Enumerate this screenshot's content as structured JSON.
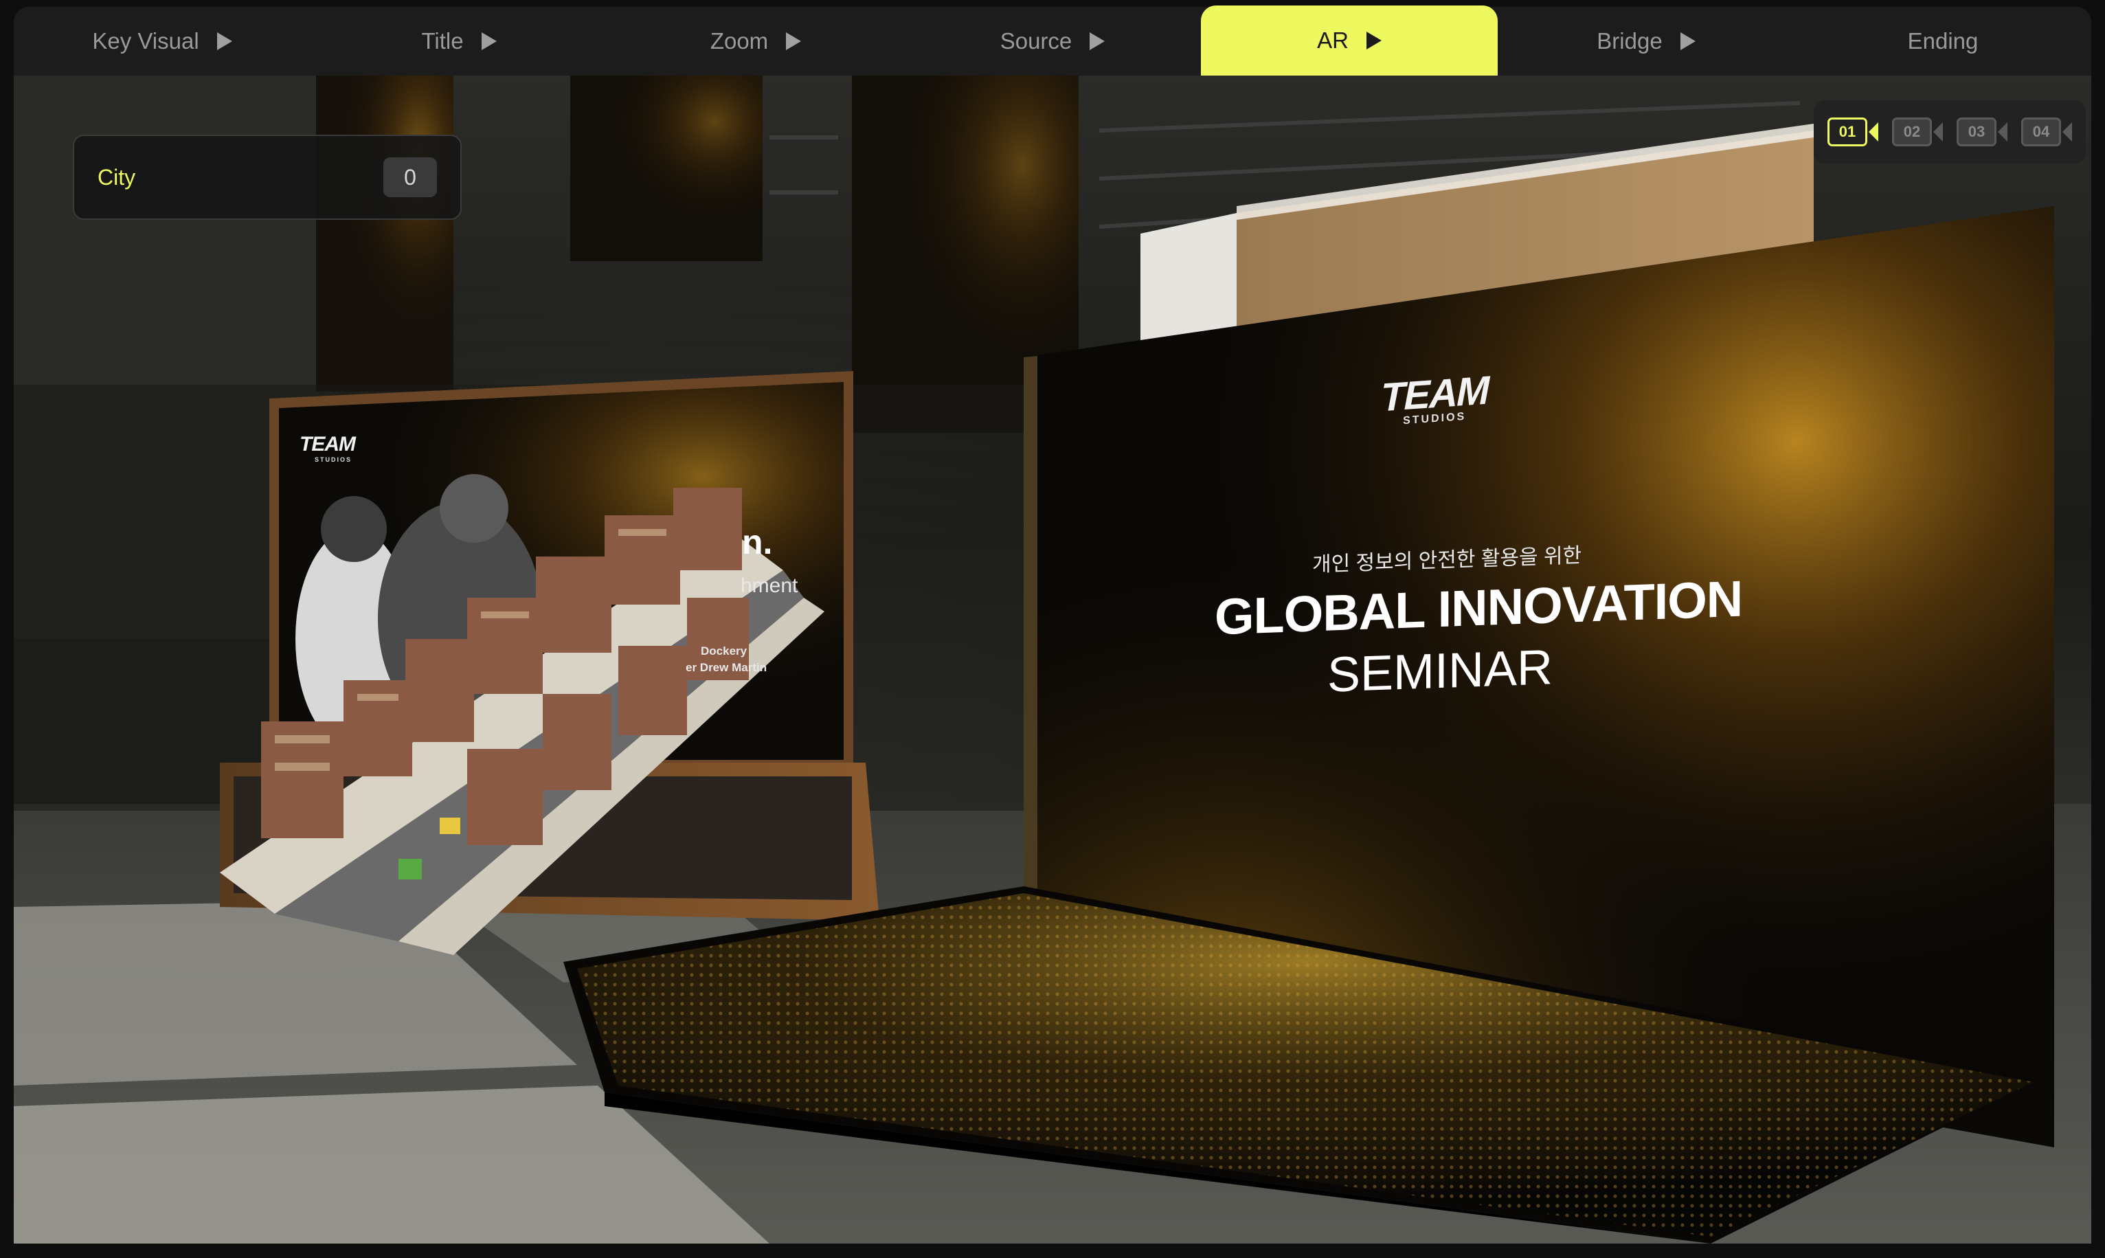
{
  "tabs": [
    {
      "label": "Key Visual",
      "play": true,
      "active": false
    },
    {
      "label": "Title",
      "play": true,
      "active": false
    },
    {
      "label": "Zoom",
      "play": true,
      "active": false
    },
    {
      "label": "Source",
      "play": true,
      "active": false
    },
    {
      "label": "AR",
      "play": true,
      "active": true
    },
    {
      "label": "Bridge",
      "play": true,
      "active": false
    },
    {
      "label": "Ending",
      "play": false,
      "active": false
    }
  ],
  "control": {
    "label": "City",
    "value": "0"
  },
  "cameras": [
    {
      "label": "01",
      "active": true,
      "icon": "camera-icon"
    },
    {
      "label": "02",
      "active": false,
      "icon": "camera-icon"
    },
    {
      "label": "03",
      "active": false,
      "icon": "camera-icon"
    },
    {
      "label": "04",
      "active": false,
      "icon": "camera-icon"
    }
  ],
  "main_screen": {
    "logo": "TEAM",
    "logo_sub": "STUDIOS",
    "kicker": "개인 정보의 안전한 활용을 위한",
    "title": "GLOBAL INNOVATION",
    "subtitle": "SEMINAR"
  },
  "side_screen": {
    "logo": "TEAM",
    "logo_sub": "STUDIOS",
    "frag_title": "n.",
    "frag_line": "hment",
    "speaker_1": "Dockery",
    "speaker_2": "er Drew Martin"
  },
  "colors": {
    "accent": "#eef95f",
    "tab_bar": "#1c1c1c",
    "gold": "#c9921c"
  }
}
